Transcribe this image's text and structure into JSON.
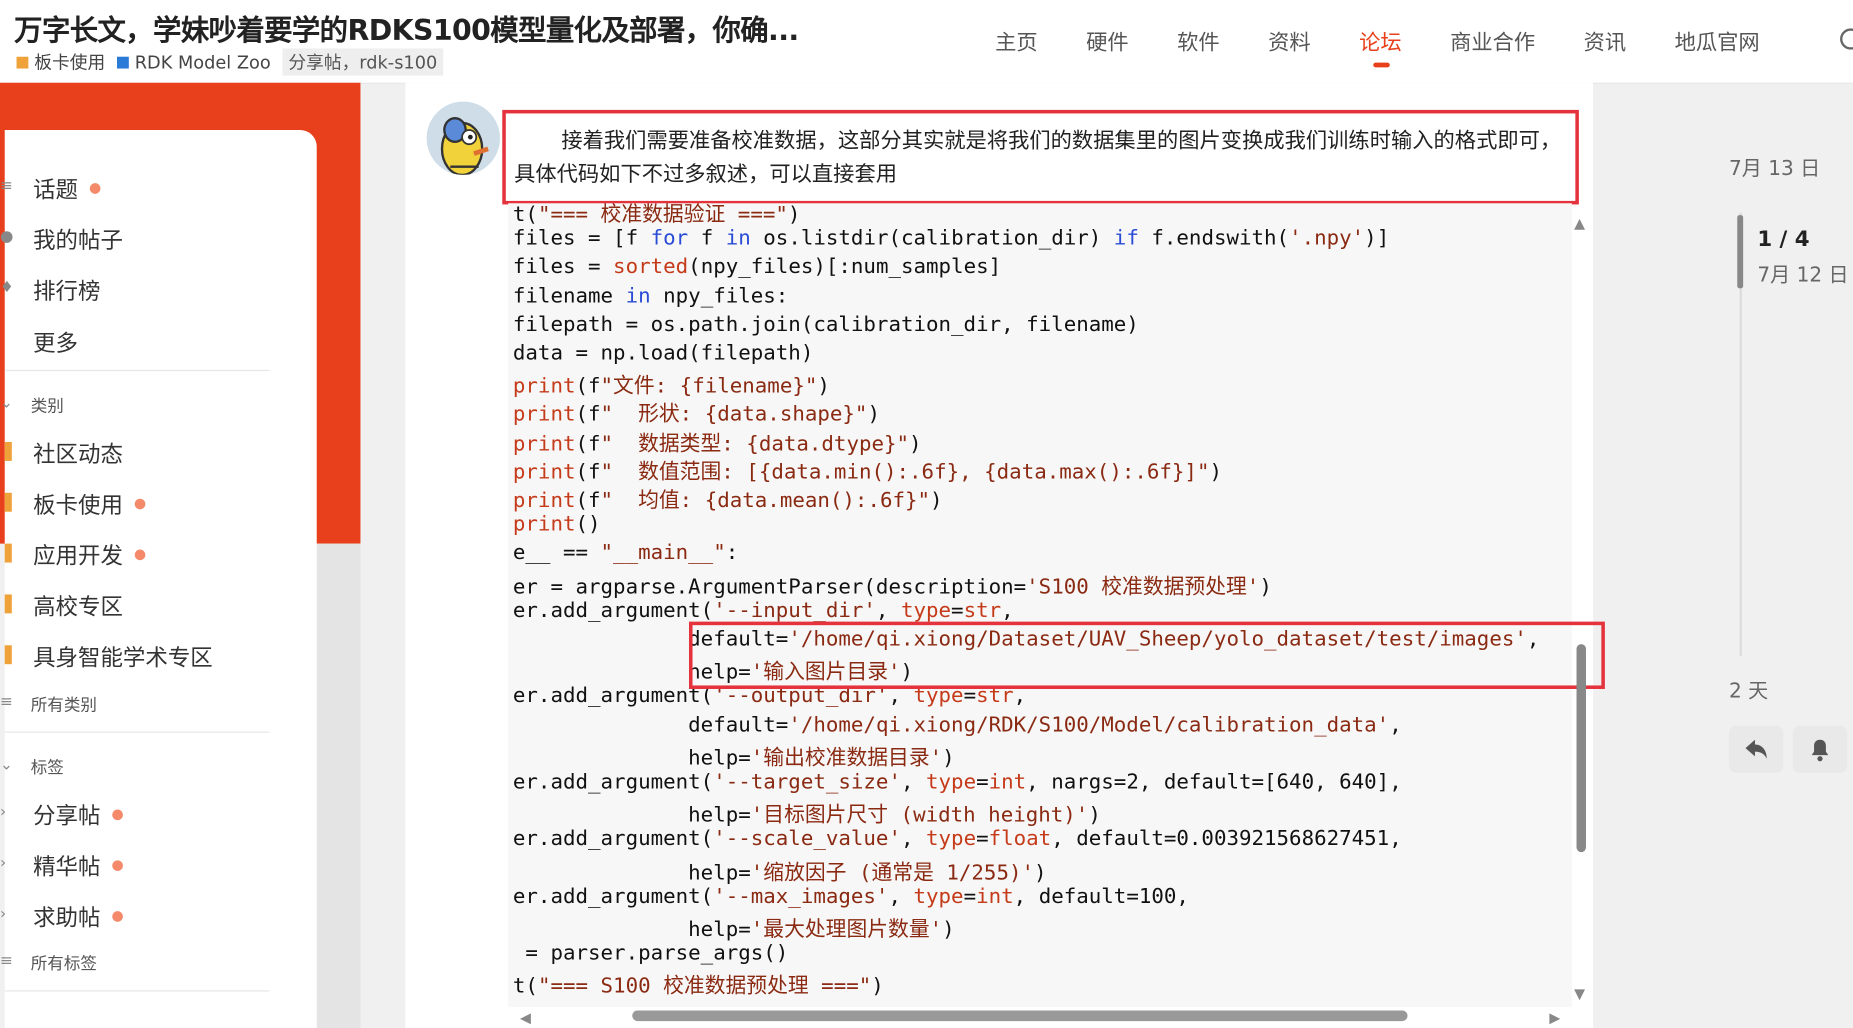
{
  "header": {
    "title": "万字长文，学妹吵着要学的RDKS100模型量化及部署，你确...",
    "categories": [
      {
        "label": "板卡使用",
        "color": "#f0a23a"
      },
      {
        "label": "RDK Model Zoo",
        "color": "#2a7ad8"
      }
    ],
    "tags": "分享帖，rdk-s100",
    "nav": [
      "主页",
      "硬件",
      "软件",
      "资料",
      "论坛",
      "商业合作",
      "资讯",
      "地瓜官网"
    ],
    "active_nav": "论坛"
  },
  "sidebar": {
    "top_items": [
      "话题",
      "我的帖子",
      "排行榜",
      "更多"
    ],
    "categories_heading": "类别",
    "categories": [
      "社区动态",
      "板卡使用",
      "应用开发",
      "高校专区",
      "具身智能学术专区"
    ],
    "all_categories": "所有类别",
    "tags_heading": "标签",
    "tags": [
      "分享帖",
      "精华帖",
      "求助帖"
    ],
    "all_tags": "所有标签"
  },
  "post": {
    "paragraph_line1": "接着我们需要准备校准数据，这部分其实就是将我们的数据集里的图片变换成我们训练时输入的格式即可，",
    "paragraph_line2": "具体代码如下不过多叙述，可以直接套用"
  },
  "code_lines": [
    "t(\"=== 校准数据验证 ===\")",
    "files = [f for f in os.listdir(calibration_dir) if f.endswith('.npy')]",
    "files = sorted(npy_files)[:num_samples]",
    "filename in npy_files:",
    "filepath = os.path.join(calibration_dir, filename)",
    "data = np.load(filepath)",
    "print(f\"文件: {filename}\")",
    "print(f\"  形状: {data.shape}\")",
    "print(f\"  数据类型: {data.dtype}\")",
    "print(f\"  数值范围: [{data.min():.6f}, {data.max():.6f}]\")",
    "print(f\"  均值: {data.mean():.6f}\")",
    "print()",
    "e__ == \"__main__\":",
    "er = argparse.ArgumentParser(description='S100 校准数据预处理')",
    "er.add_argument('--input_dir', type=str,",
    "              default='/home/qi.xiong/Dataset/UAV_Sheep/yolo_dataset/test/images',",
    "              help='输入图片目录')",
    "er.add_argument('--output_dir', type=str,",
    "              default='/home/qi.xiong/RDK/S100/Model/calibration_data',",
    "              help='输出校准数据目录')",
    "er.add_argument('--target_size', type=int, nargs=2, default=[640, 640],",
    "              help='目标图片尺寸 (width height)')",
    "er.add_argument('--scale_value', type=float, default=0.003921568627451,",
    "              help='缩放因子 (通常是 1/255)')",
    "er.add_argument('--max_images', type=int, default=100,",
    "              help='最大处理图片数量')",
    " = parser.parse_args()",
    "t(\"=== S100 校准数据预处理 ===\")"
  ],
  "timeline": {
    "start_date": "7月 13 日",
    "position": "1 / 4",
    "current_date": "7月 12 日",
    "ago": "2 天"
  },
  "colors": {
    "brand_red": "#e8401c",
    "annotation_red": "#e5333d",
    "keyword_blue": "#2a4bd6"
  },
  "icons": [
    "search-icon",
    "reply-icon",
    "bell-icon"
  ]
}
